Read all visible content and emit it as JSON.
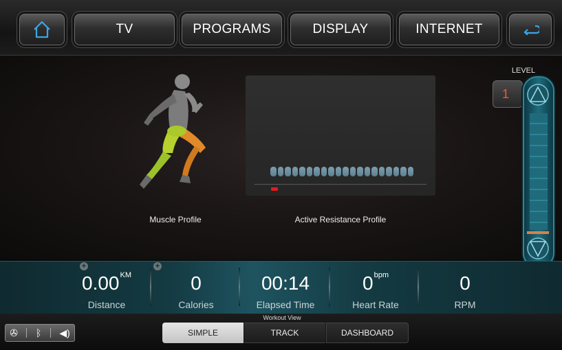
{
  "nav": {
    "tv_label": "TV",
    "programs_label": "PROGRAMS",
    "display_label": "DISPLAY",
    "internet_label": "INTERNET",
    "home_icon": "home-icon",
    "back_icon": "back-icon"
  },
  "main": {
    "muscle_profile_label": "Muscle Profile",
    "resistance_profile_label": "Active Resistance Profile",
    "resistance_bar_count": 20
  },
  "level": {
    "label": "LEVEL",
    "value": "1"
  },
  "stats": {
    "distance": {
      "value": "0.00",
      "unit": "KM",
      "label": "Distance"
    },
    "calories": {
      "value": "0",
      "label": "Calories"
    },
    "elapsed": {
      "value": "00:14",
      "label": "Elapsed Time"
    },
    "heart_rate": {
      "value": "0",
      "unit": "bpm",
      "label": "Heart Rate"
    },
    "rpm": {
      "value": "0",
      "label": "RPM"
    }
  },
  "workout_view": {
    "label": "Workout View",
    "tabs": [
      "SIMPLE",
      "TRACK",
      "DASHBOARD"
    ],
    "selected": "SIMPLE"
  },
  "status_icons": [
    "fan-icon",
    "bluetooth-icon",
    "volume-icon"
  ],
  "colors": {
    "accent": "#2f8799",
    "level_value": "#f05a3a",
    "resistance_bar": "#5d7f8f",
    "track_marker": "#e01c1c"
  }
}
